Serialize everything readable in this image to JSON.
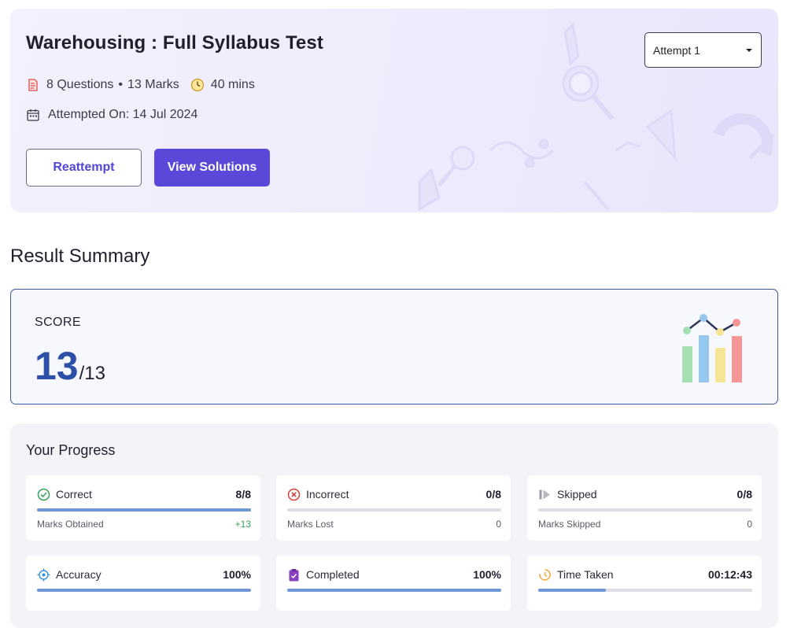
{
  "header": {
    "title": "Warehousing : Full Syllabus Test",
    "questions": "8 Questions",
    "marks": "13 Marks",
    "duration": "40 mins",
    "attempted_on": "Attempted On: 14 Jul 2024",
    "reattempt_label": "Reattempt",
    "view_solutions_label": "View Solutions",
    "attempt_select_value": "Attempt 1",
    "icons": [
      "questions-doc-icon",
      "clock-icon",
      "calendar-icon",
      "chevron-down-icon"
    ]
  },
  "summary": {
    "section_title": "Result Summary",
    "score_label": "SCORE",
    "score": "13",
    "score_total": "/13"
  },
  "progress": {
    "title": "Your Progress",
    "stats": [
      {
        "label": "Correct",
        "value": "8/8",
        "fill_percent": 100,
        "sub_label": "Marks Obtained",
        "sub_value": "+13",
        "icon": "check-circle-icon",
        "icon_color": "#3aa35a"
      },
      {
        "label": "Incorrect",
        "value": "0/8",
        "fill_percent": 0,
        "sub_label": "Marks Lost",
        "sub_value": "0",
        "icon": "x-circle-icon",
        "icon_color": "#d9413b"
      },
      {
        "label": "Skipped",
        "value": "0/8",
        "fill_percent": 0,
        "sub_label": "Marks Skipped",
        "sub_value": "0",
        "icon": "skip-icon",
        "icon_color": "#9a9aa4"
      },
      {
        "label": "Accuracy",
        "value": "100%",
        "fill_percent": 100,
        "icon": "target-icon",
        "icon_color": "#3b8fd6"
      },
      {
        "label": "Completed",
        "value": "100%",
        "fill_percent": 100,
        "icon": "clipboard-icon",
        "icon_color": "#8a3fbf"
      },
      {
        "label": "Time Taken",
        "value": "00:12:43",
        "fill_percent": 31.8,
        "icon": "stopwatch-icon",
        "icon_color": "#f0a93a"
      }
    ]
  },
  "colors": {
    "primary": "#5a49d8",
    "score_blue": "#2c4fa8",
    "progress_fill": "#6f97d6",
    "hero_bg": "#eeebfc"
  }
}
